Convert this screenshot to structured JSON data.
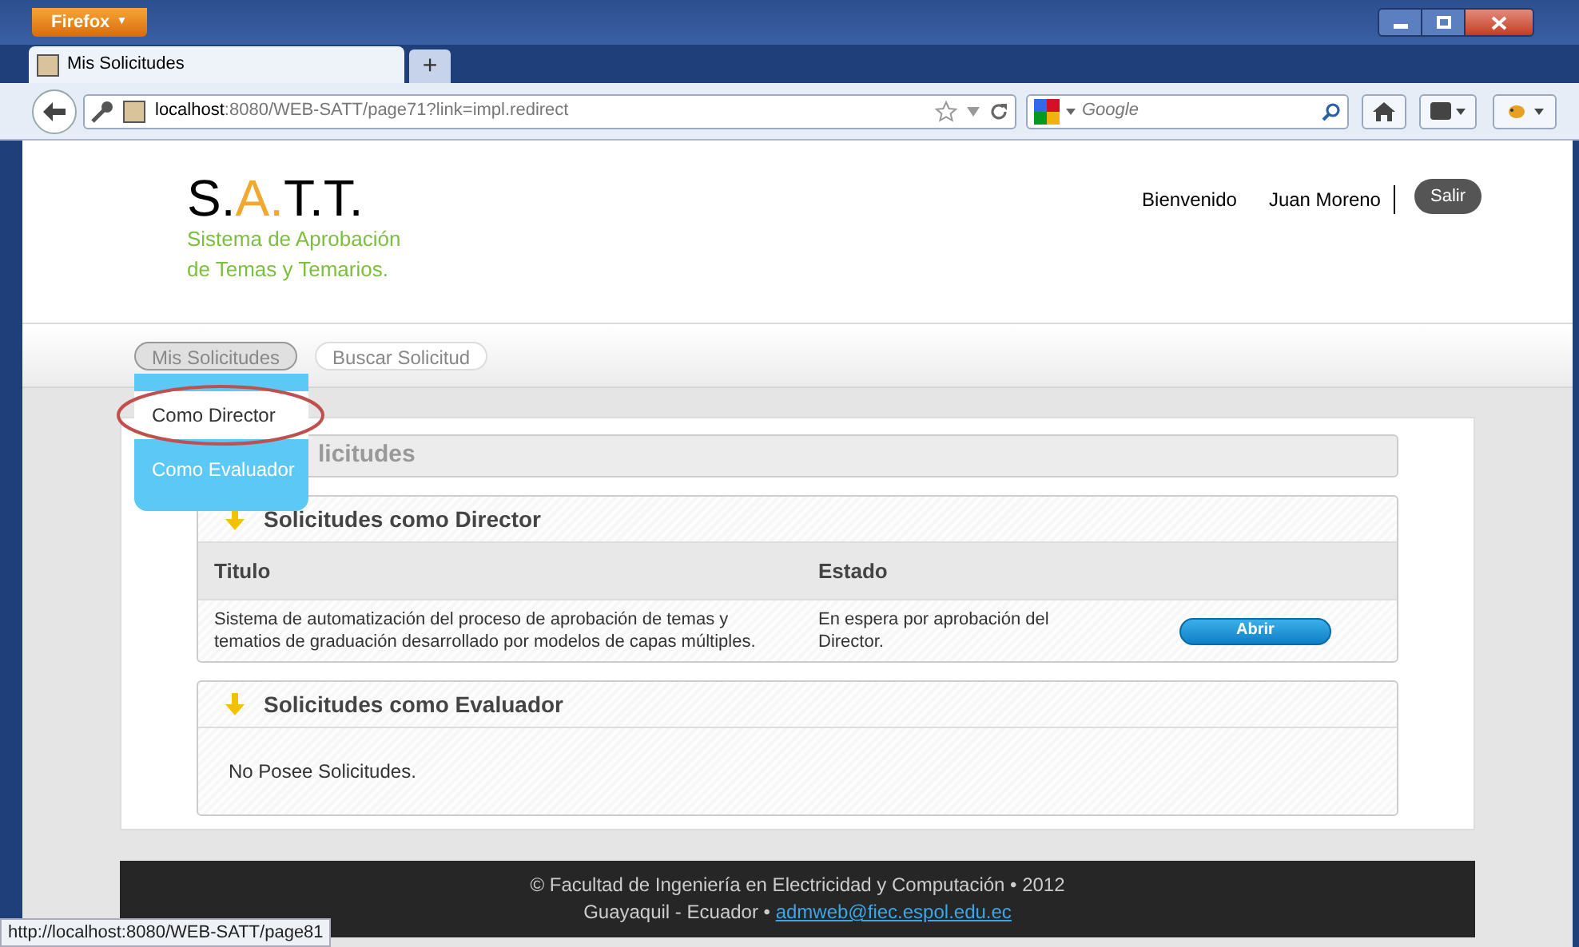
{
  "browser": {
    "menu_button": "Firefox",
    "menu_caret": "▼",
    "tabs": [
      {
        "title": "Mis Solicitudes",
        "selected": true
      }
    ],
    "new_tab": "+",
    "url_host": "localhost",
    "url_path": ":8080/WEB-SATT/page71?link=impl.redirect",
    "search": {
      "placeholder": "Google"
    }
  },
  "header": {
    "logo_parts": [
      {
        "text": "S.",
        "accent": false
      },
      {
        "text": "A.",
        "accent": true
      },
      {
        "text": "T.T.",
        "accent": false
      }
    ],
    "subtitle_lines": [
      "Sistema de Aprobación",
      "de Temas y Temarios."
    ],
    "welcome": "Bienvenido",
    "user": "Juan Moreno",
    "logout": "Salir"
  },
  "nav": [
    {
      "label": "Mis Solicitudes",
      "selected": true
    },
    {
      "label": "Buscar Solicitud",
      "selected": false
    }
  ],
  "dropdown": [
    {
      "label": "Como Director",
      "selected": true
    },
    {
      "label": "Como Evaluador",
      "selected": false
    }
  ],
  "page_title": "licitudes",
  "director_panel": {
    "title": "Solicitudes como Director",
    "columns": [
      "Titulo",
      "Estado"
    ],
    "rows": [
      {
        "titulo": "Sistema de automatización del proceso de aprobación de temas y tematios de graduación desarrollado por modelos de capas múltiples.",
        "estado": "En espera por aprobación del Director.",
        "action": "Abrir"
      }
    ]
  },
  "evaluator_panel": {
    "title": "Solicitudes como Evaluador",
    "empty": "No Posee Solicitudes."
  },
  "footer": {
    "line1": "© Facultad de Ingeniería en Electricidad y Computación • 2012",
    "line2": "Guayaquil - Ecuador • ",
    "email": "admweb@fiec.espol.edu.ec"
  },
  "status_bar": "http://localhost:8080/WEB-SATT/page81"
}
